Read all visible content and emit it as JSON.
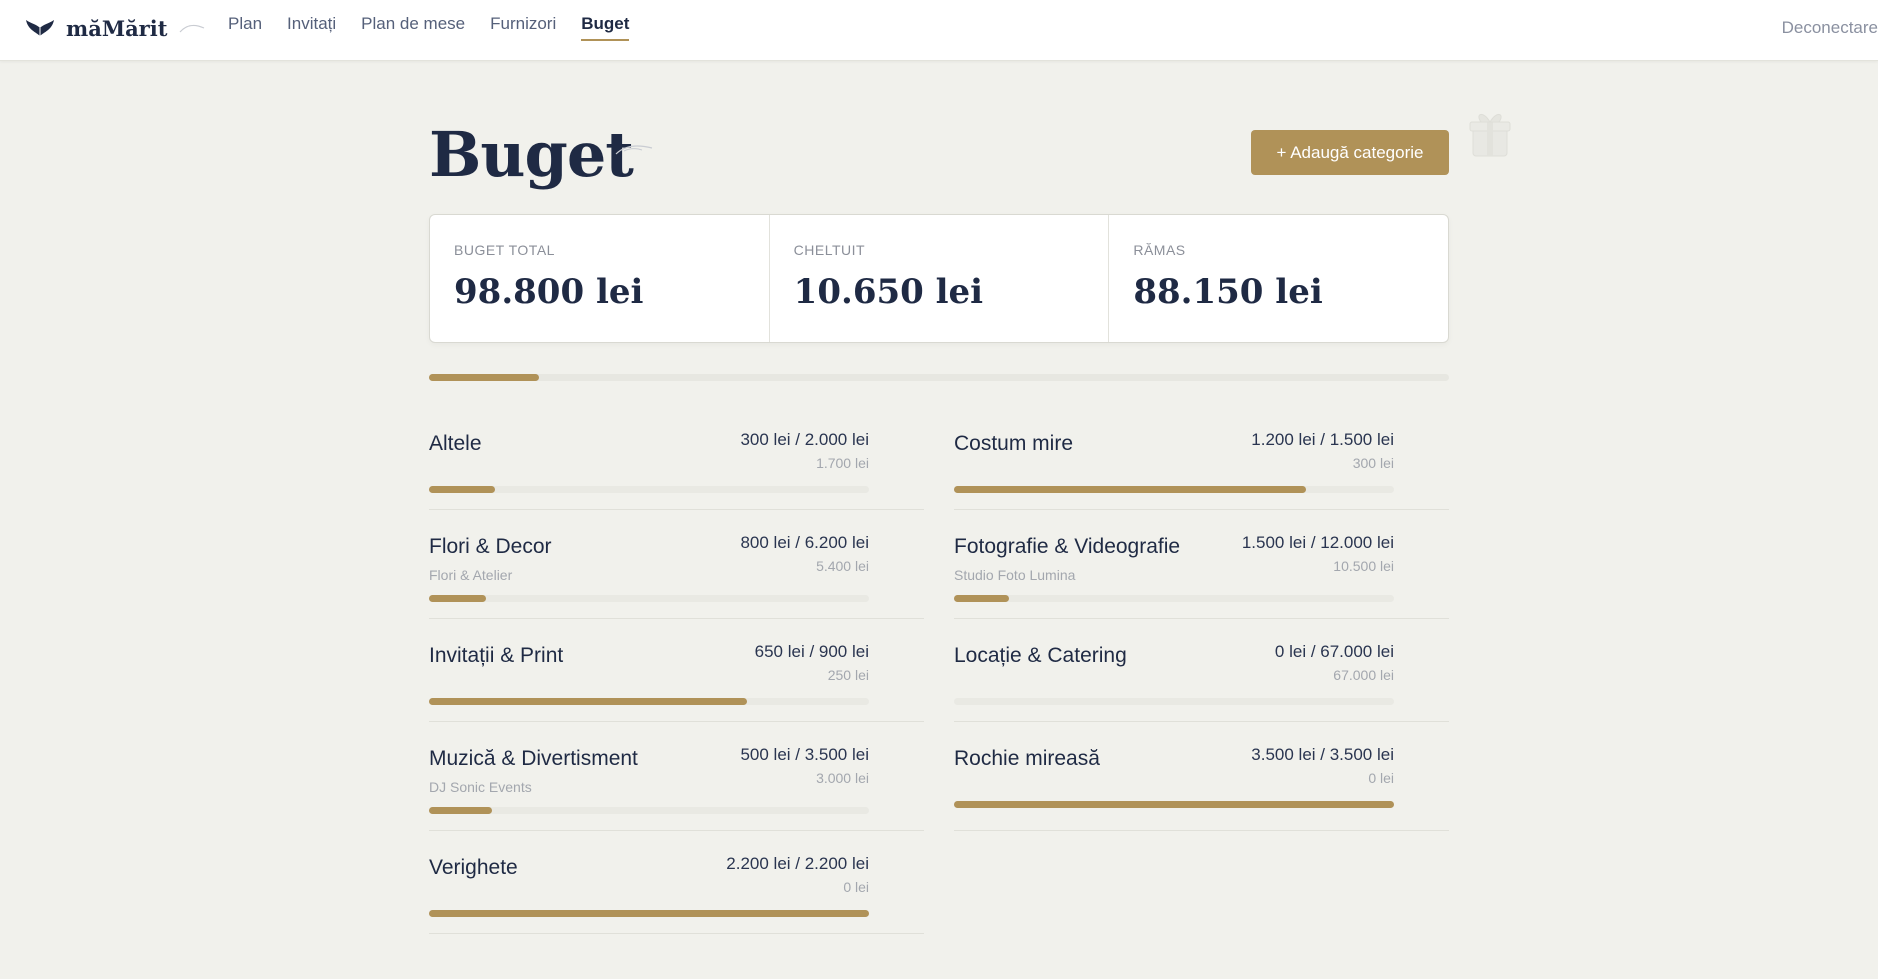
{
  "app": {
    "name": "măMărit"
  },
  "nav": {
    "items": [
      {
        "label": "Plan",
        "active": false
      },
      {
        "label": "Invitați",
        "active": false
      },
      {
        "label": "Plan de mese",
        "active": false
      },
      {
        "label": "Furnizori",
        "active": false
      },
      {
        "label": "Buget",
        "active": true
      }
    ],
    "logout": "Deconectare"
  },
  "page": {
    "title": "Buget",
    "add_button": "+ Adaugă categorie"
  },
  "summary": {
    "total": {
      "label": "BUGET TOTAL",
      "value": "98.800 lei"
    },
    "spent": {
      "label": "CHELTUIT",
      "value": "10.650 lei"
    },
    "remaining": {
      "label": "RĂMAS",
      "value": "88.150 lei"
    },
    "spent_fraction": 0.108
  },
  "categories": [
    {
      "name": "Altele",
      "vendor": "",
      "amount": "300 lei / 2.000 lei",
      "remaining": "1.700 lei",
      "fraction": 0.15
    },
    {
      "name": "Costum mire",
      "vendor": "",
      "amount": "1.200 lei / 1.500 lei",
      "remaining": "300 lei",
      "fraction": 0.8
    },
    {
      "name": "Flori & Decor",
      "vendor": "Flori & Atelier",
      "amount": "800 lei / 6.200 lei",
      "remaining": "5.400 lei",
      "fraction": 0.129
    },
    {
      "name": "Fotografie & Videografie",
      "vendor": "Studio Foto Lumina",
      "amount": "1.500 lei / 12.000 lei",
      "remaining": "10.500 lei",
      "fraction": 0.125
    },
    {
      "name": "Invitații & Print",
      "vendor": "",
      "amount": "650 lei / 900 lei",
      "remaining": "250 lei",
      "fraction": 0.722
    },
    {
      "name": "Locație & Catering",
      "vendor": "",
      "amount": "0 lei / 67.000 lei",
      "remaining": "67.000 lei",
      "fraction": 0
    },
    {
      "name": "Muzică & Divertisment",
      "vendor": "DJ Sonic Events",
      "amount": "500 lei / 3.500 lei",
      "remaining": "3.000 lei",
      "fraction": 0.143
    },
    {
      "name": "Rochie mireasă",
      "vendor": "",
      "amount": "3.500 lei / 3.500 lei",
      "remaining": "0 lei",
      "fraction": 1
    },
    {
      "name": "Verighete",
      "vendor": "",
      "amount": "2.200 lei / 2.200 lei",
      "remaining": "0 lei",
      "fraction": 1
    }
  ],
  "colors": {
    "accent": "#b09258",
    "text": "#1f2a44",
    "background": "#f1f1ec"
  }
}
